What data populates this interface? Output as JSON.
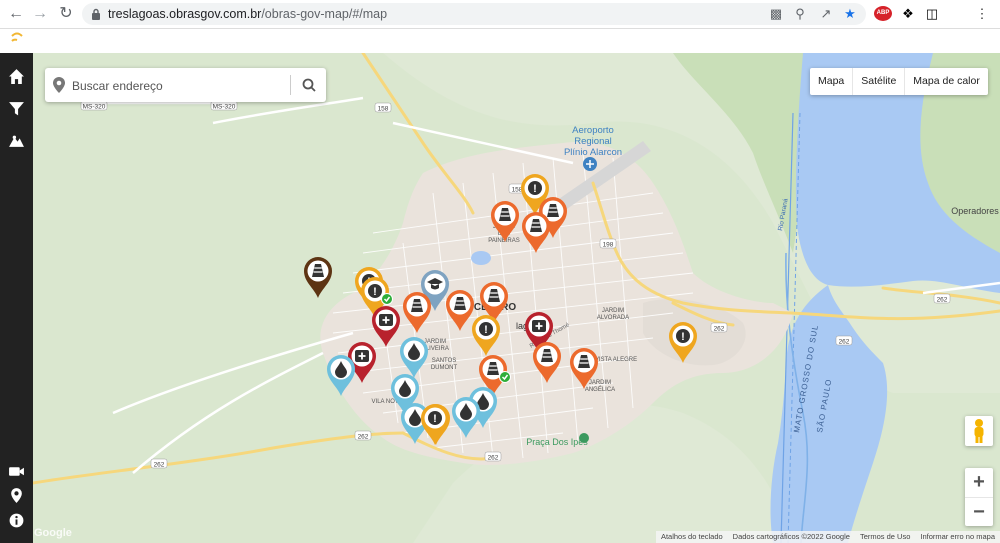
{
  "browser": {
    "url_host": "treslagoas.obrasgov.com.br",
    "url_path": "/obras-gov-map/#/map",
    "extension_badge": "ABP"
  },
  "sidebar": {
    "items": [
      {
        "icon": "home-icon"
      },
      {
        "icon": "filter-icon"
      },
      {
        "icon": "landscape-icon"
      },
      {
        "icon": "video-icon"
      },
      {
        "icon": "location-pin-icon"
      },
      {
        "icon": "info-icon"
      }
    ]
  },
  "search": {
    "placeholder": "Buscar endereço"
  },
  "map_type": {
    "options": [
      "Mapa",
      "Satélite",
      "Mapa de calor"
    ]
  },
  "zoom": {
    "in": "+",
    "out": "−"
  },
  "footer": {
    "shortcuts": "Atalhos do teclado",
    "map_data": "Dados cartográficos ©2022 Google",
    "terms": "Termos de Uso",
    "report": "Informar erro no mapa"
  },
  "map_labels": {
    "airport": [
      "Aeroporto",
      "Regional",
      "Plínio Alarcon"
    ],
    "centro": "CENTRO",
    "lagoa": "lagoa",
    "operadores": "Operadores",
    "jardim_paineiras": [
      "JARDIM",
      "DAS",
      "PAINEIRAS"
    ],
    "jardim_alvorada": [
      "JARDIM",
      "ALVORADA"
    ],
    "jardim_oliveira": [
      "JARDIM",
      "OLIVEIRA"
    ],
    "santos_dumont": [
      "SANTOS",
      "DUMONT"
    ],
    "vista_alegre": "VISTA ALEGRE",
    "jardim_angelica": [
      "JARDIM",
      "ANGÉLICA"
    ],
    "vila_nova": "VILA NOVA",
    "praca": "Praça Dos Ipês",
    "rio_parana": "Rio Paraná",
    "mato_grosso_do_sul": "MATO GROSSO DO SUL",
    "sao_paulo": "SÃO PAULO",
    "ms_320": "MS-320",
    "road_158": "158",
    "road_198": "198",
    "road_262": "262",
    "google": "Google"
  },
  "colors": {
    "sidebar": "#222222",
    "water": "#a9c9f3",
    "river_blue": "#6fa3e6",
    "urban": "#eae3dc",
    "pin_orange": "#ec6a2d",
    "pin_yellow": "#efa61f",
    "pin_red": "#b8222d",
    "pin_blue": "#6ec0dd",
    "pin_brown": "#5d3413",
    "pin_slate": "#7fa3c1"
  },
  "markers": [
    {
      "type": "cone",
      "color": "orange"
    },
    {
      "type": "alert",
      "color": "yellow"
    },
    {
      "type": "cone",
      "color": "orange"
    },
    {
      "type": "cone",
      "color": "orange"
    },
    {
      "type": "cone",
      "color": "brown"
    },
    {
      "type": "alert",
      "color": "yellow"
    },
    {
      "type": "alert",
      "color": "yellow",
      "status": "done"
    },
    {
      "type": "education",
      "color": "slate"
    },
    {
      "type": "cone",
      "color": "orange"
    },
    {
      "type": "cone",
      "color": "orange"
    },
    {
      "type": "cone",
      "color": "orange"
    },
    {
      "type": "alert",
      "color": "yellow"
    },
    {
      "type": "health",
      "color": "red"
    },
    {
      "type": "health",
      "color": "red"
    },
    {
      "type": "health",
      "color": "red"
    },
    {
      "type": "water",
      "color": "blue"
    },
    {
      "type": "water",
      "color": "blue"
    },
    {
      "type": "water",
      "color": "blue"
    },
    {
      "type": "cone",
      "color": "orange"
    },
    {
      "type": "cone",
      "color": "orange"
    },
    {
      "type": "alert",
      "color": "yellow"
    },
    {
      "type": "cone",
      "color": "orange",
      "status": "done"
    },
    {
      "type": "water",
      "color": "blue"
    },
    {
      "type": "water",
      "color": "blue"
    },
    {
      "type": "water",
      "color": "blue"
    },
    {
      "type": "alert",
      "color": "yellow"
    },
    {
      "type": "alert",
      "color": "yellow"
    }
  ]
}
